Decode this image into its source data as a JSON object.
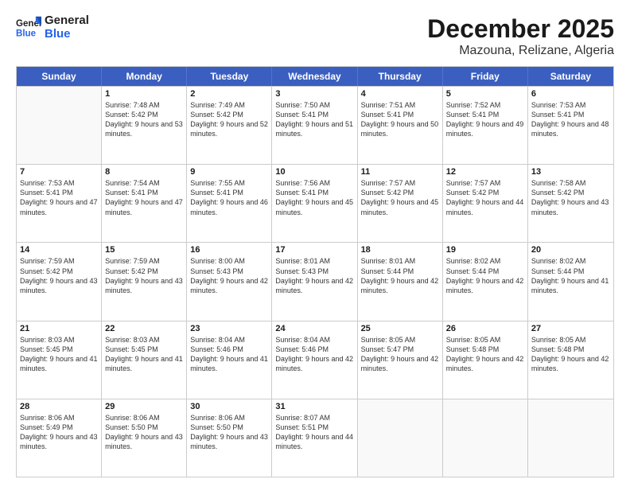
{
  "header": {
    "logo_general": "General",
    "logo_blue": "Blue",
    "month": "December 2025",
    "location": "Mazouna, Relizane, Algeria"
  },
  "days_of_week": [
    "Sunday",
    "Monday",
    "Tuesday",
    "Wednesday",
    "Thursday",
    "Friday",
    "Saturday"
  ],
  "weeks": [
    [
      {
        "day": "",
        "info": "",
        "empty": true
      },
      {
        "day": "1",
        "info": "Sunrise: 7:48 AM\nSunset: 5:42 PM\nDaylight: 9 hours\nand 53 minutes.",
        "empty": false
      },
      {
        "day": "2",
        "info": "Sunrise: 7:49 AM\nSunset: 5:42 PM\nDaylight: 9 hours\nand 52 minutes.",
        "empty": false
      },
      {
        "day": "3",
        "info": "Sunrise: 7:50 AM\nSunset: 5:41 PM\nDaylight: 9 hours\nand 51 minutes.",
        "empty": false
      },
      {
        "day": "4",
        "info": "Sunrise: 7:51 AM\nSunset: 5:41 PM\nDaylight: 9 hours\nand 50 minutes.",
        "empty": false
      },
      {
        "day": "5",
        "info": "Sunrise: 7:52 AM\nSunset: 5:41 PM\nDaylight: 9 hours\nand 49 minutes.",
        "empty": false
      },
      {
        "day": "6",
        "info": "Sunrise: 7:53 AM\nSunset: 5:41 PM\nDaylight: 9 hours\nand 48 minutes.",
        "empty": false
      }
    ],
    [
      {
        "day": "7",
        "info": "Sunrise: 7:53 AM\nSunset: 5:41 PM\nDaylight: 9 hours\nand 47 minutes.",
        "empty": false
      },
      {
        "day": "8",
        "info": "Sunrise: 7:54 AM\nSunset: 5:41 PM\nDaylight: 9 hours\nand 47 minutes.",
        "empty": false
      },
      {
        "day": "9",
        "info": "Sunrise: 7:55 AM\nSunset: 5:41 PM\nDaylight: 9 hours\nand 46 minutes.",
        "empty": false
      },
      {
        "day": "10",
        "info": "Sunrise: 7:56 AM\nSunset: 5:41 PM\nDaylight: 9 hours\nand 45 minutes.",
        "empty": false
      },
      {
        "day": "11",
        "info": "Sunrise: 7:57 AM\nSunset: 5:42 PM\nDaylight: 9 hours\nand 45 minutes.",
        "empty": false
      },
      {
        "day": "12",
        "info": "Sunrise: 7:57 AM\nSunset: 5:42 PM\nDaylight: 9 hours\nand 44 minutes.",
        "empty": false
      },
      {
        "day": "13",
        "info": "Sunrise: 7:58 AM\nSunset: 5:42 PM\nDaylight: 9 hours\nand 43 minutes.",
        "empty": false
      }
    ],
    [
      {
        "day": "14",
        "info": "Sunrise: 7:59 AM\nSunset: 5:42 PM\nDaylight: 9 hours\nand 43 minutes.",
        "empty": false
      },
      {
        "day": "15",
        "info": "Sunrise: 7:59 AM\nSunset: 5:42 PM\nDaylight: 9 hours\nand 43 minutes.",
        "empty": false
      },
      {
        "day": "16",
        "info": "Sunrise: 8:00 AM\nSunset: 5:43 PM\nDaylight: 9 hours\nand 42 minutes.",
        "empty": false
      },
      {
        "day": "17",
        "info": "Sunrise: 8:01 AM\nSunset: 5:43 PM\nDaylight: 9 hours\nand 42 minutes.",
        "empty": false
      },
      {
        "day": "18",
        "info": "Sunrise: 8:01 AM\nSunset: 5:44 PM\nDaylight: 9 hours\nand 42 minutes.",
        "empty": false
      },
      {
        "day": "19",
        "info": "Sunrise: 8:02 AM\nSunset: 5:44 PM\nDaylight: 9 hours\nand 42 minutes.",
        "empty": false
      },
      {
        "day": "20",
        "info": "Sunrise: 8:02 AM\nSunset: 5:44 PM\nDaylight: 9 hours\nand 41 minutes.",
        "empty": false
      }
    ],
    [
      {
        "day": "21",
        "info": "Sunrise: 8:03 AM\nSunset: 5:45 PM\nDaylight: 9 hours\nand 41 minutes.",
        "empty": false
      },
      {
        "day": "22",
        "info": "Sunrise: 8:03 AM\nSunset: 5:45 PM\nDaylight: 9 hours\nand 41 minutes.",
        "empty": false
      },
      {
        "day": "23",
        "info": "Sunrise: 8:04 AM\nSunset: 5:46 PM\nDaylight: 9 hours\nand 41 minutes.",
        "empty": false
      },
      {
        "day": "24",
        "info": "Sunrise: 8:04 AM\nSunset: 5:46 PM\nDaylight: 9 hours\nand 42 minutes.",
        "empty": false
      },
      {
        "day": "25",
        "info": "Sunrise: 8:05 AM\nSunset: 5:47 PM\nDaylight: 9 hours\nand 42 minutes.",
        "empty": false
      },
      {
        "day": "26",
        "info": "Sunrise: 8:05 AM\nSunset: 5:48 PM\nDaylight: 9 hours\nand 42 minutes.",
        "empty": false
      },
      {
        "day": "27",
        "info": "Sunrise: 8:05 AM\nSunset: 5:48 PM\nDaylight: 9 hours\nand 42 minutes.",
        "empty": false
      }
    ],
    [
      {
        "day": "28",
        "info": "Sunrise: 8:06 AM\nSunset: 5:49 PM\nDaylight: 9 hours\nand 43 minutes.",
        "empty": false
      },
      {
        "day": "29",
        "info": "Sunrise: 8:06 AM\nSunset: 5:50 PM\nDaylight: 9 hours\nand 43 minutes.",
        "empty": false
      },
      {
        "day": "30",
        "info": "Sunrise: 8:06 AM\nSunset: 5:50 PM\nDaylight: 9 hours\nand 43 minutes.",
        "empty": false
      },
      {
        "day": "31",
        "info": "Sunrise: 8:07 AM\nSunset: 5:51 PM\nDaylight: 9 hours\nand 44 minutes.",
        "empty": false
      },
      {
        "day": "",
        "info": "",
        "empty": true
      },
      {
        "day": "",
        "info": "",
        "empty": true
      },
      {
        "day": "",
        "info": "",
        "empty": true
      }
    ]
  ]
}
